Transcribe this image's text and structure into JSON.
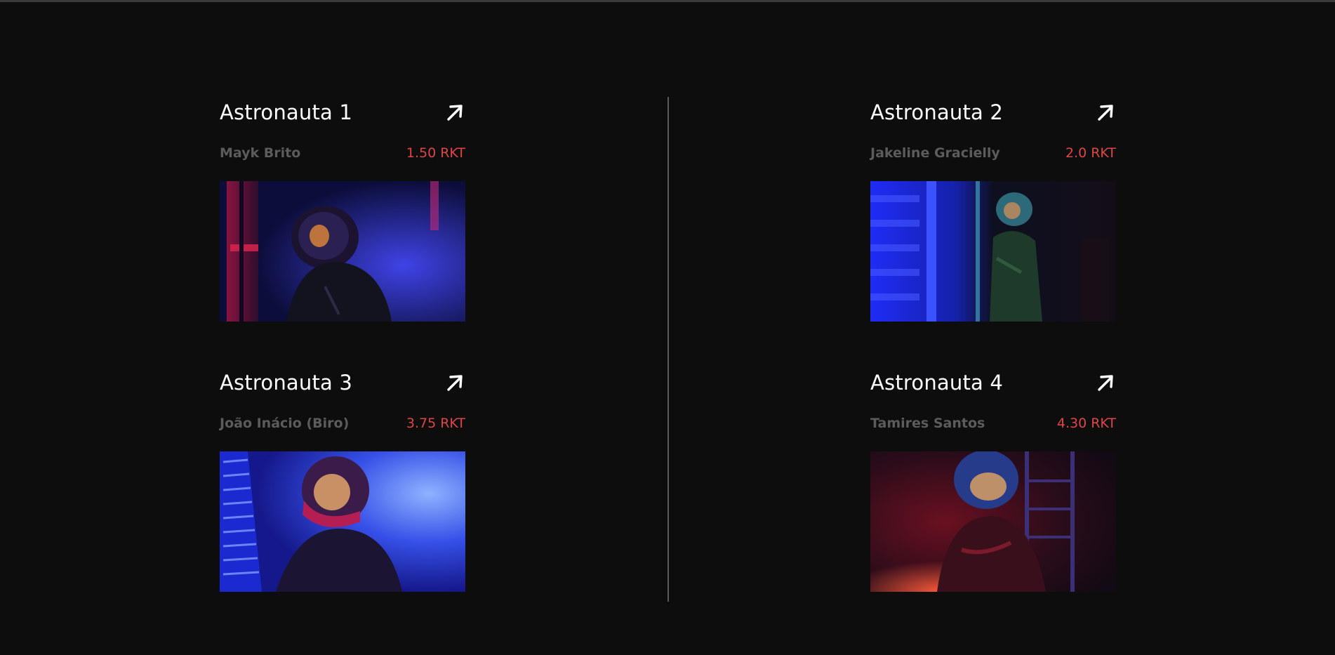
{
  "cards": [
    {
      "title": "Astronauta 1",
      "author": "Mayk Brito",
      "price": "1.50 RKT",
      "link_icon": "arrow-up-right-icon",
      "image": "astronaut-photo-blue-red"
    },
    {
      "title": "Astronauta 2",
      "author": "Jakeline Gracielly",
      "price": "2.0 RKT",
      "link_icon": "arrow-up-right-icon",
      "image": "astronaut-photo-blue-green"
    },
    {
      "title": "Astronauta 3",
      "author": "João Inácio (Biro)",
      "price": "3.75 RKT",
      "link_icon": "arrow-up-right-icon",
      "image": "astronaut-photo-blue-light"
    },
    {
      "title": "Astronauta 4",
      "author": "Tamires Santos",
      "price": "4.30 RKT",
      "link_icon": "arrow-up-right-icon",
      "image": "astronaut-photo-red"
    }
  ],
  "colors": {
    "background": "#0d0d0d",
    "title": "#ffffff",
    "author": "#5c5c5c",
    "price": "#e04545",
    "divider": "#5a5a5a"
  }
}
